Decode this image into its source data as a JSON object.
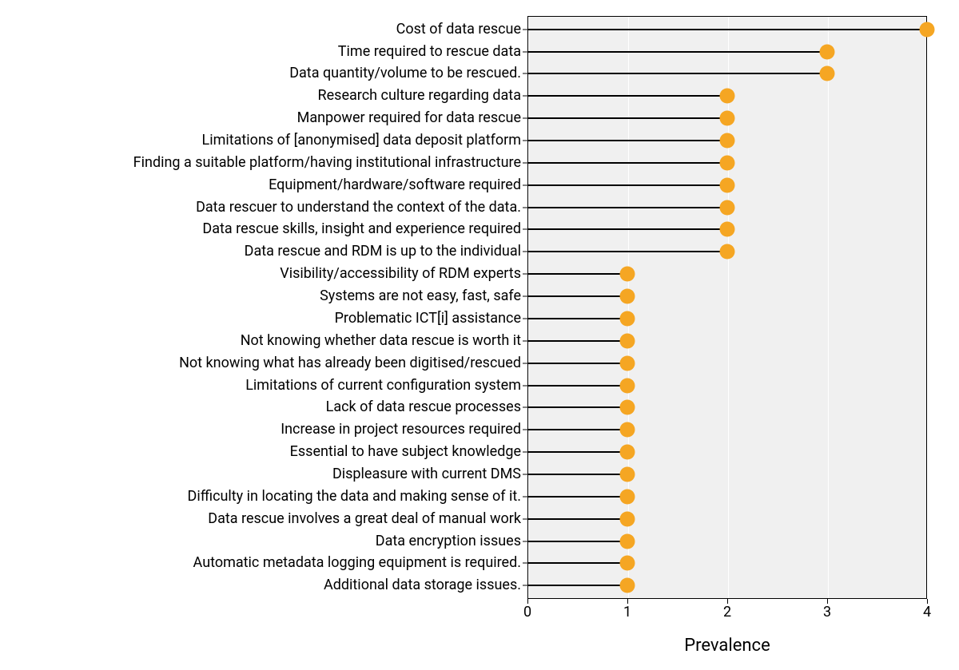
{
  "chart_data": {
    "type": "lollipop",
    "xlabel": "Prevalence",
    "ylabel": "",
    "xlim": [
      0,
      4
    ],
    "xticks": [
      0,
      1,
      2,
      3,
      4
    ],
    "dot_color": "#f5a623",
    "categories": [
      "Cost of data rescue",
      "Time required to rescue data",
      "Data quantity/volume to be rescued.",
      "Research culture regarding data",
      "Manpower required for data rescue",
      "Limitations of [anonymised] data deposit platform",
      "Finding a suitable platform/having institutional infrastructure",
      "Equipment/hardware/software required",
      "Data rescuer to understand the context of the data.",
      "Data rescue skills, insight and experience required",
      "Data rescue and RDM is up to the individual",
      "Visibility/accessibility of RDM experts",
      "Systems are not easy, fast, safe",
      "Problematic ICT[i] assistance",
      "Not knowing whether data rescue is worth it",
      "Not knowing what has already been digitised/rescued",
      "Limitations of current configuration system",
      "Lack of data rescue processes",
      "Increase in project resources required",
      "Essential to have subject knowledge",
      "Displeasure with current DMS",
      "Difficulty in locating the data and making sense of it.",
      "Data rescue involves a great deal of manual work",
      "Data encryption issues",
      "Automatic metadata logging equipment is required.",
      "Additional data storage issues."
    ],
    "values": [
      4,
      3,
      3,
      2,
      2,
      2,
      2,
      2,
      2,
      2,
      2,
      1,
      1,
      1,
      1,
      1,
      1,
      1,
      1,
      1,
      1,
      1,
      1,
      1,
      1,
      1
    ]
  }
}
